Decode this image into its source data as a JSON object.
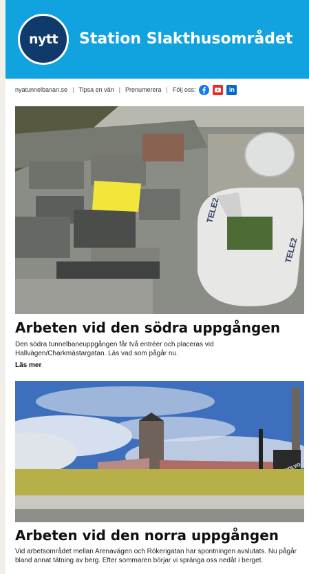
{
  "header": {
    "logo_text": "nytt",
    "title": "Station Slakthusområdet",
    "bg_color": "#11a2e0"
  },
  "nav": {
    "site": "nyatunnelbanan.se",
    "tip": "Tipsa en vän",
    "subscribe": "Prenumerera",
    "follow": "Följ oss:",
    "icons": [
      "facebook-icon",
      "youtube-icon",
      "linkedin-icon"
    ]
  },
  "articles": [
    {
      "heading": "Arbeten vid den södra uppgången",
      "body": "Den södra tunnelbaneuppgången får två entréer och placeras vid Hallvägen/Charkmästargatan. Läs vad som pågår nu.",
      "more": "Läs mer",
      "image_text": "TELE2"
    },
    {
      "heading": "Arbeten vid den norra uppgången",
      "body": "Vid arbetsområdet mellan Arenavägen och Rökerigatan har spontningen avslutats. Nu pågår bland annat tätning av berg. Efter sommaren börjar vi spränga oss nedåt i berget.",
      "image_text": "VOLVO"
    }
  ]
}
